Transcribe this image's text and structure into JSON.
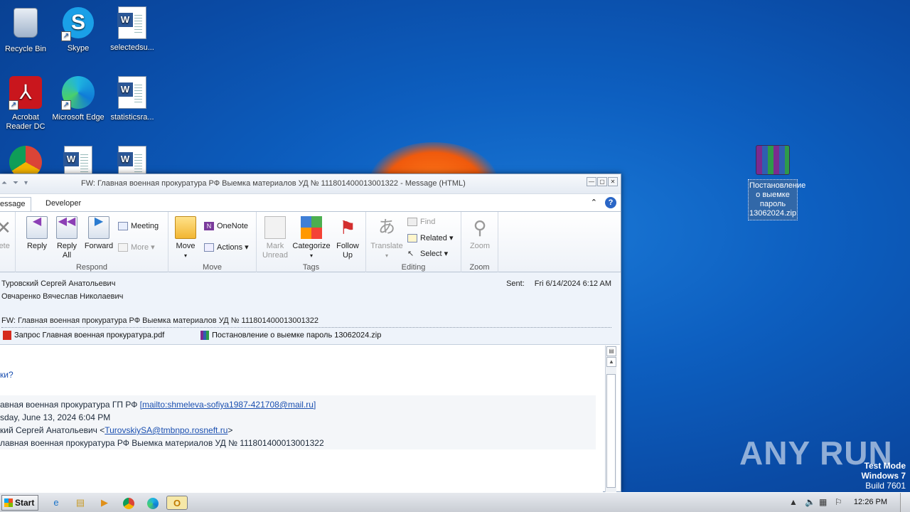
{
  "desktop": {
    "icons": [
      {
        "label": "Recycle Bin",
        "icon": "recycle-bin-icon"
      },
      {
        "label": "Skype",
        "icon": "skype-icon"
      },
      {
        "label": "selectedsu...",
        "icon": "word-document-icon"
      },
      {
        "label": "Acrobat Reader DC",
        "icon": "acrobat-icon"
      },
      {
        "label": "Microsoft Edge",
        "icon": "edge-icon"
      },
      {
        "label": "statisticsra...",
        "icon": "word-document-icon"
      }
    ],
    "rar_file": {
      "label": "Постановление о выемке пароль 13062024.zip",
      "icon": "winrar-archive-icon"
    },
    "watermark": "ANY RUN",
    "test_mode": {
      "line1": "Test Mode",
      "line2": "Windows 7",
      "line3": "Build 7601"
    }
  },
  "window": {
    "title": "FW: Главная военная прокуратура РФ Выемка материалов УД № 111801400013001322   -  Message (HTML)",
    "tabs": {
      "message": "essage",
      "developer": "Developer"
    },
    "ribbon": {
      "delete_label": "lete",
      "respond": {
        "group": "Respond",
        "reply": "Reply",
        "reply_all": "Reply All",
        "forward": "Forward",
        "meeting": "Meeting",
        "more": "More"
      },
      "move": {
        "group": "Move",
        "move": "Move",
        "onenote": "OneNote",
        "actions": "Actions"
      },
      "tags": {
        "group": "Tags",
        "mark_unread": "Mark Unread",
        "categorize": "Categorize",
        "follow_up": "Follow Up"
      },
      "editing": {
        "group": "Editing",
        "translate": "Translate",
        "find": "Find",
        "related": "Related",
        "select": "Select"
      },
      "zoom": {
        "group": "Zoom",
        "zoom": "Zoom"
      }
    },
    "header": {
      "from": "Туровский Сергей Анатольевич",
      "to": "Овчаренко Вячеслав Николаевич",
      "sent_label": "Sent:",
      "sent_value": "Fri 6/14/2024 6:12 AM",
      "subject": "FW: Главная военная прокуратура РФ Выемка материалов УД № 111801400013001322",
      "attachments": [
        {
          "name": "Запрос Главная военная прокуратура.pdf",
          "icon": "pdf-icon"
        },
        {
          "name": "Постановление о выемке  пароль 13062024.zip",
          "icon": "winrar-icon"
        }
      ]
    },
    "body": {
      "line1": "ки?",
      "quoted_from_prefix": "авная военная прокуратура ГП РФ ",
      "quoted_from_link": "[mailto:shmeleva-sofiya1987-421708@mail.ru]",
      "quoted_sent": "sday, June 13, 2024 6:04 PM",
      "quoted_to_prefix": "кий Сергей Анатольевич <",
      "quoted_to_link": "TurovskiySA@tmbnpo.rosneft.ru",
      "quoted_to_suffix": ">",
      "quoted_subject": "лавная военная прокуратура РФ Выемка материалов УД № 111801400013001322"
    }
  },
  "taskbar": {
    "start": "Start",
    "clock": "12:26 PM",
    "apps": [
      "ie-icon",
      "explorer-icon",
      "media-player-icon",
      "chrome-icon",
      "edge-icon",
      "outlook-icon"
    ]
  }
}
